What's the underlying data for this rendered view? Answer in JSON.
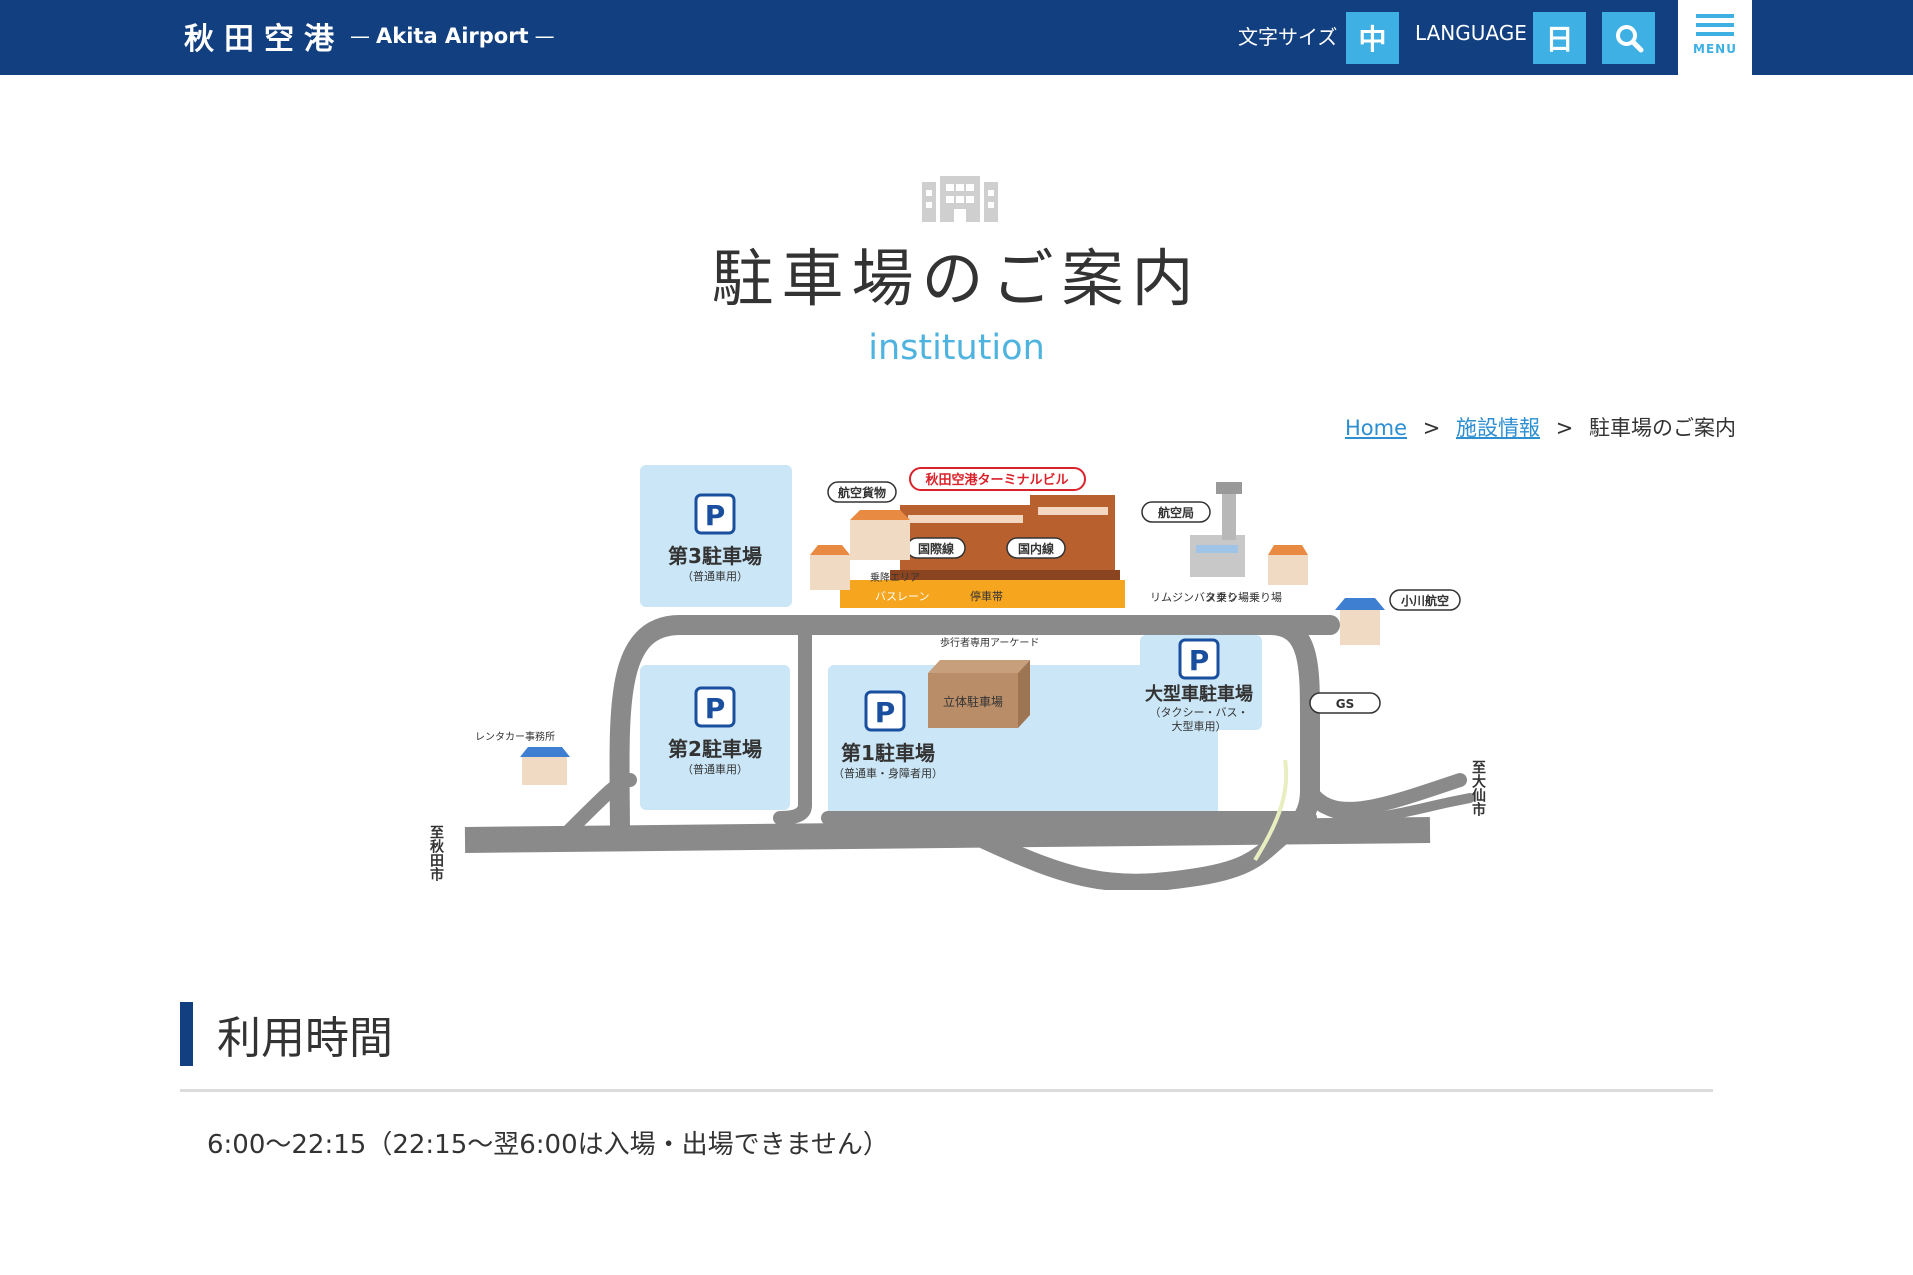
{
  "header": {
    "logo_jp": "秋田空港",
    "logo_en": "Akita Airport",
    "font_size_label": "文字サイズ",
    "font_size_value": "中",
    "language_label": "LANGUAGE",
    "language_value": "日",
    "menu_label": "MENU"
  },
  "page": {
    "title": "駐車場のご案内",
    "subtitle": "institution"
  },
  "breadcrumb": {
    "home": "Home",
    "parent": "施設情報",
    "current": "駐車場のご案内",
    "separator": ">"
  },
  "map": {
    "terminal": "秋田空港ターミナルビル",
    "air_cargo": "航空貨物",
    "aviation_bureau": "航空局",
    "international": "国際線",
    "domestic": "国内線",
    "drop_off_area": "乗降エリア",
    "bus_lane": "バスレーン",
    "stop": "停車帯",
    "limousine_bus": "リムジンバス乗り場",
    "taxi": "タクシー乗り場",
    "walkway": "歩行者専用アーケード",
    "ogawa": "小川航空",
    "gs": "GS",
    "rental_car": "レンタカー事務所",
    "parking_symbol": "P",
    "lot3": "第3駐車場",
    "lot3_note": "（普通車用）",
    "lot2": "第2駐車場",
    "lot2_note": "（普通車用）",
    "lot1": "第1駐車場",
    "lot1_note": "（普通車・身障者用）",
    "multi_storey": "立体駐車場",
    "large": "大型車駐車場",
    "large_note1": "（タクシー・バス・",
    "large_note2": "大型車用）",
    "to_akita_city": "至秋田市",
    "to_daisen_city": "至大仙市"
  },
  "section": {
    "title": "利用時間",
    "hours": "6:00〜22:15（22:15〜翌6:00は入場・出場できません）"
  },
  "colors": {
    "header_bg": "#123f7f",
    "accent": "#3fb0e3",
    "parking_bg": "#cbe6f6",
    "road": "#8a8a8a",
    "terminal": "#b8612f"
  },
  "icons": {
    "search": "search-icon",
    "menu": "hamburger-icon",
    "title": "building-icon"
  }
}
